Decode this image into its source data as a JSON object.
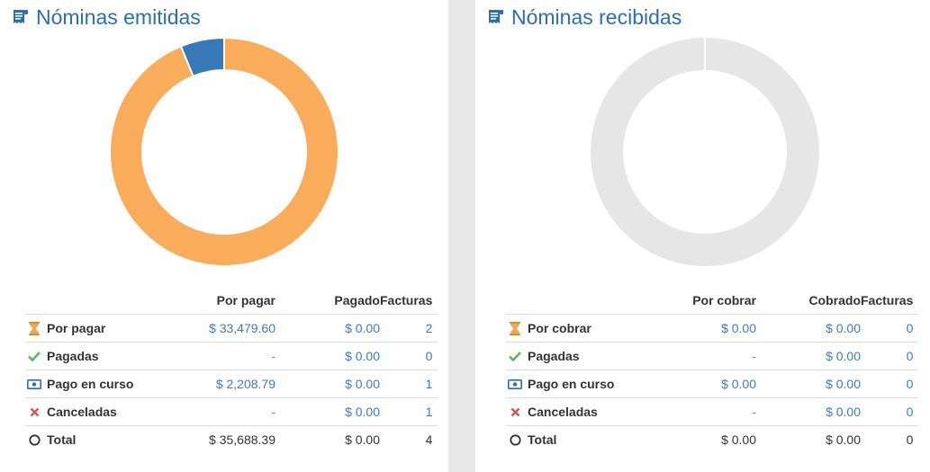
{
  "panels": {
    "emitidas": {
      "title": "Nóminas emitidas",
      "headers": {
        "col_a": "Por pagar",
        "col_b": "Pagado",
        "col_n": "Facturas"
      },
      "rows": [
        {
          "label": "Por pagar",
          "icon": "hourglass-icon",
          "a": "$ 33,479.60",
          "b": "$ 0.00",
          "n": "2"
        },
        {
          "label": "Pagadas",
          "icon": "check-icon",
          "a": "-",
          "b": "$ 0.00",
          "n": "0"
        },
        {
          "label": "Pago en curso",
          "icon": "money-icon",
          "a": "$ 2,208.79",
          "b": "$ 0.00",
          "n": "1"
        },
        {
          "label": "Canceladas",
          "icon": "cross-icon",
          "a": "-",
          "b": "$ 0.00",
          "n": "1"
        },
        {
          "label": "Total",
          "icon": "circle-icon",
          "a": "$ 35,688.39",
          "b": "$ 0.00",
          "n": "4"
        }
      ]
    },
    "recibidas": {
      "title": "Nóminas recibidas",
      "headers": {
        "col_a": "Por cobrar",
        "col_b": "Cobrado",
        "col_n": "Facturas"
      },
      "rows": [
        {
          "label": "Por cobrar",
          "icon": "hourglass-icon",
          "a": "$ 0.00",
          "b": "$ 0.00",
          "n": "0"
        },
        {
          "label": "Pagadas",
          "icon": "check-icon",
          "a": "-",
          "b": "$ 0.00",
          "n": "0"
        },
        {
          "label": "Pago en curso",
          "icon": "money-icon",
          "a": "$ 0.00",
          "b": "$ 0.00",
          "n": "0"
        },
        {
          "label": "Canceladas",
          "icon": "cross-icon",
          "a": "-",
          "b": "$ 0.00",
          "n": "0"
        },
        {
          "label": "Total",
          "icon": "circle-icon",
          "a": "$ 0.00",
          "b": "$ 0.00",
          "n": "0"
        }
      ]
    }
  },
  "chart_data": [
    {
      "type": "pie",
      "categories": [
        "Por pagar",
        "Pago en curso"
      ],
      "values": [
        33479.6,
        2208.79
      ],
      "colors": [
        "#f9ac5a",
        "#3678b8"
      ]
    },
    {
      "type": "pie",
      "categories": [],
      "values": [],
      "empty_color": "#e6e6e6"
    }
  ],
  "colors": {
    "title": "#2a6fb5",
    "link": "#3b7bbf",
    "hourglass": "#f0a850",
    "check": "#5cb85c",
    "money": "#2a6fb5",
    "cross": "#d9534f"
  }
}
